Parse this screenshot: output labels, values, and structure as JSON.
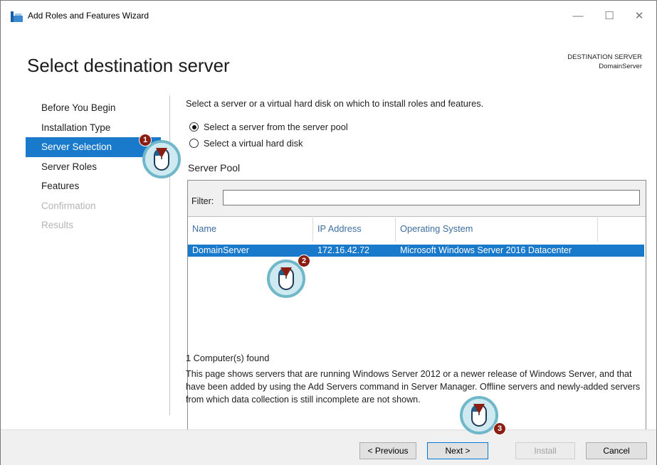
{
  "window": {
    "title": "Add Roles and Features Wizard",
    "minimize": "—",
    "maximize": "☐",
    "close": "✕"
  },
  "header": {
    "page_title": "Select destination server",
    "destination_label": "DESTINATION SERVER",
    "destination_value": "DomainServer"
  },
  "nav": {
    "items": [
      {
        "label": "Before You Begin",
        "state": "normal"
      },
      {
        "label": "Installation Type",
        "state": "normal"
      },
      {
        "label": "Server Selection",
        "state": "active"
      },
      {
        "label": "Server Roles",
        "state": "normal"
      },
      {
        "label": "Features",
        "state": "normal"
      },
      {
        "label": "Confirmation",
        "state": "disabled"
      },
      {
        "label": "Results",
        "state": "disabled"
      }
    ]
  },
  "content": {
    "intro": "Select a server or a virtual hard disk on which to install roles and features.",
    "radio_pool": "Select a server from the server pool",
    "radio_vhd": "Select a virtual hard disk",
    "pool_label": "Server Pool",
    "filter_label": "Filter:",
    "filter_value": "",
    "columns": [
      "Name",
      "IP Address",
      "Operating System"
    ],
    "rows": [
      {
        "name": "DomainServer",
        "ip": "172.16.42.72",
        "os": "Microsoft Windows Server 2016 Datacenter"
      }
    ],
    "found": "1 Computer(s) found",
    "description": "This page shows servers that are running Windows Server 2012 or a newer release of Windows Server, and that have been added by using the Add Servers command in Server Manager. Offline servers and newly-added servers from which data collection is still incomplete are not shown."
  },
  "footer": {
    "previous": "< Previous",
    "next": "Next >",
    "install": "Install",
    "cancel": "Cancel"
  },
  "callouts": [
    "1",
    "2",
    "3"
  ],
  "colors": {
    "accent": "#1979ca",
    "callout": "#8b1e12",
    "callout_ring": "#6fb7c9"
  }
}
